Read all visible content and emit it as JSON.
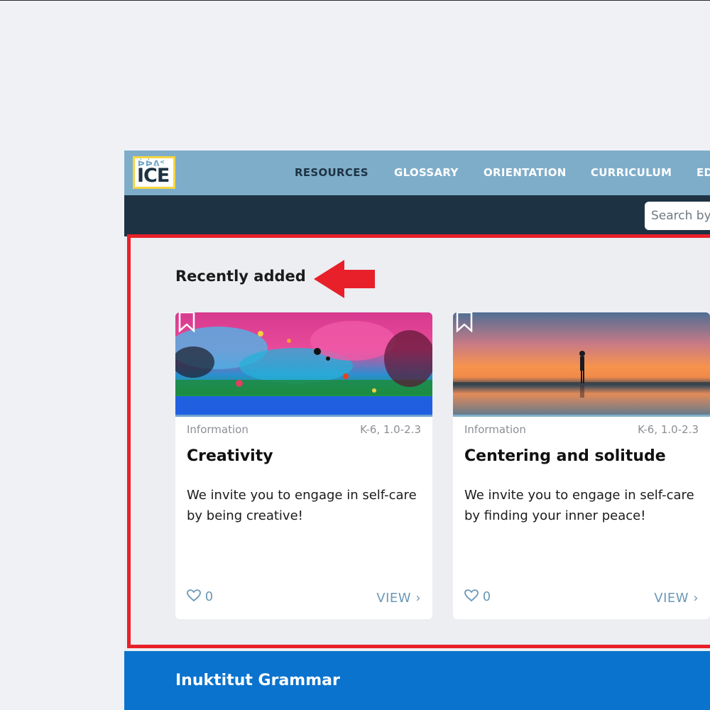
{
  "nav": {
    "logo_syllabics": "ᐆᐆᕕᑉ",
    "logo_text": "ICE",
    "items": [
      "RESOURCES",
      "GLOSSARY",
      "ORIENTATION",
      "CURRICULUM",
      "ED"
    ],
    "active": "RESOURCES"
  },
  "search": {
    "placeholder": "Search by"
  },
  "section": {
    "title": "Recently added"
  },
  "cards": [
    {
      "category": "Information",
      "grade": "K-6, 1.0-2.3",
      "title": "Creativity",
      "description": "We invite you to engage in self-care by being creative!",
      "likes": "0",
      "view": "VIEW ›"
    },
    {
      "category": "Information",
      "grade": "K-6, 1.0-2.3",
      "title": "Centering and solitude",
      "description": "We invite you to engage in self-care by finding your inner peace!",
      "likes": "0",
      "view": "VIEW ›"
    }
  ],
  "footer": {
    "title": "Inuktitut Grammar"
  },
  "colors": {
    "nav": "#7eadc9",
    "subbar": "#1d3344",
    "highlight": "#e8202a",
    "footer": "#0a73cd",
    "link": "#6b98b8"
  }
}
